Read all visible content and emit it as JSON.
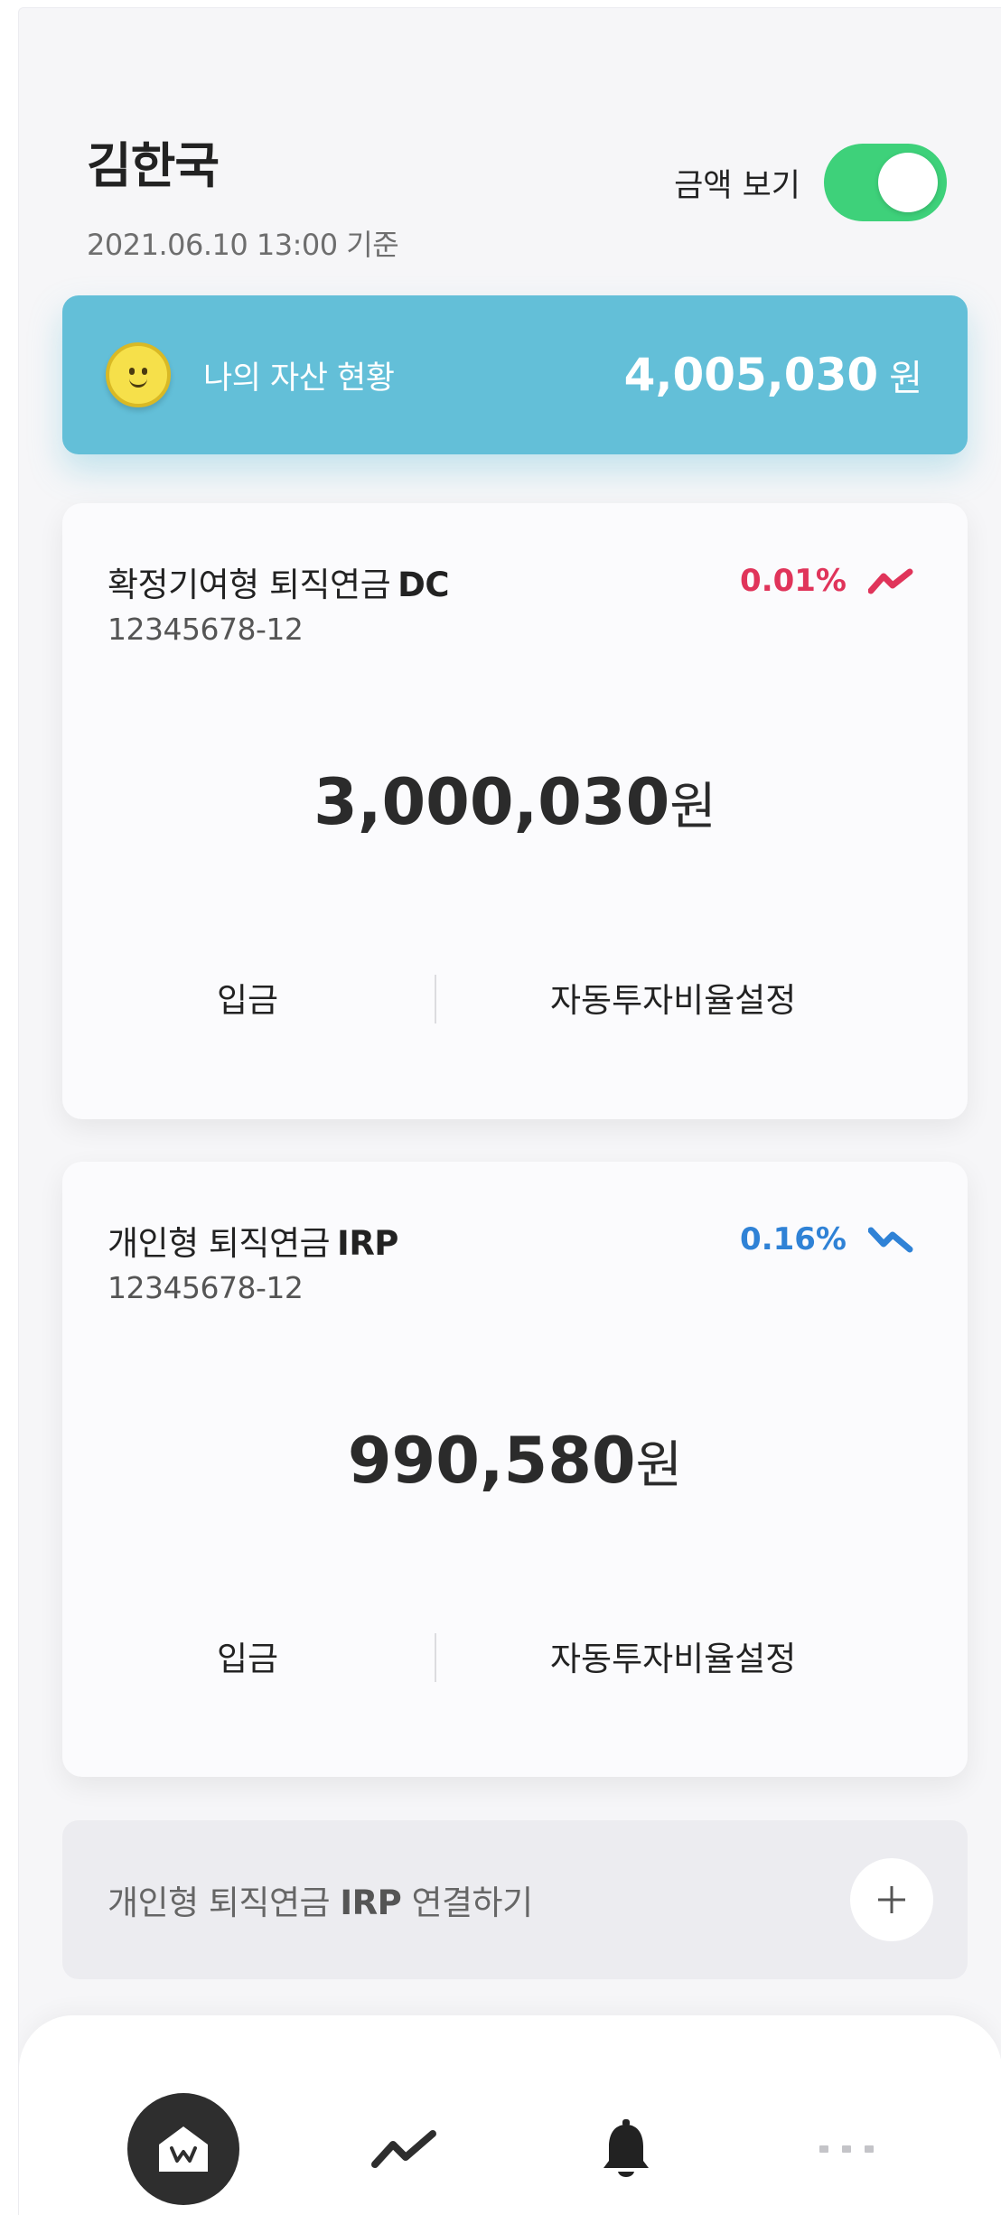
{
  "header": {
    "user_name": "김한국",
    "base_time": "2021.06.10 13:00 기준",
    "toggle_label": "금액 보기",
    "toggle_on": true
  },
  "asset_summary": {
    "label": "나의 자산 현황",
    "amount": "4,005,030",
    "unit": "원"
  },
  "accounts": [
    {
      "title": "확정기여형 퇴직연금",
      "type": "DC",
      "account_number": "12345678-12",
      "rate": "0.01%",
      "trend": "up",
      "amount": "3,000,030",
      "unit": "원",
      "deposit_label": "입금",
      "auto_invest_label": "자동투자비율설정"
    },
    {
      "title": "개인형 퇴직연금",
      "type": "IRP",
      "account_number": "12345678-12",
      "rate": "0.16%",
      "trend": "down",
      "amount": "990,580",
      "unit": "원",
      "deposit_label": "입금",
      "auto_invest_label": "자동투자비율설정"
    }
  ],
  "connect": {
    "prefix": "개인형 퇴직연금",
    "type": "IRP",
    "suffix": "연결하기"
  },
  "colors": {
    "toggle": "#3ed17a",
    "banner": "#63bfd8",
    "rate_up": "#e0345a",
    "rate_down": "#2f82d6"
  },
  "tabbar": {
    "icons": [
      "home-icon",
      "chart-icon",
      "bell-icon",
      "more-icon"
    ]
  }
}
